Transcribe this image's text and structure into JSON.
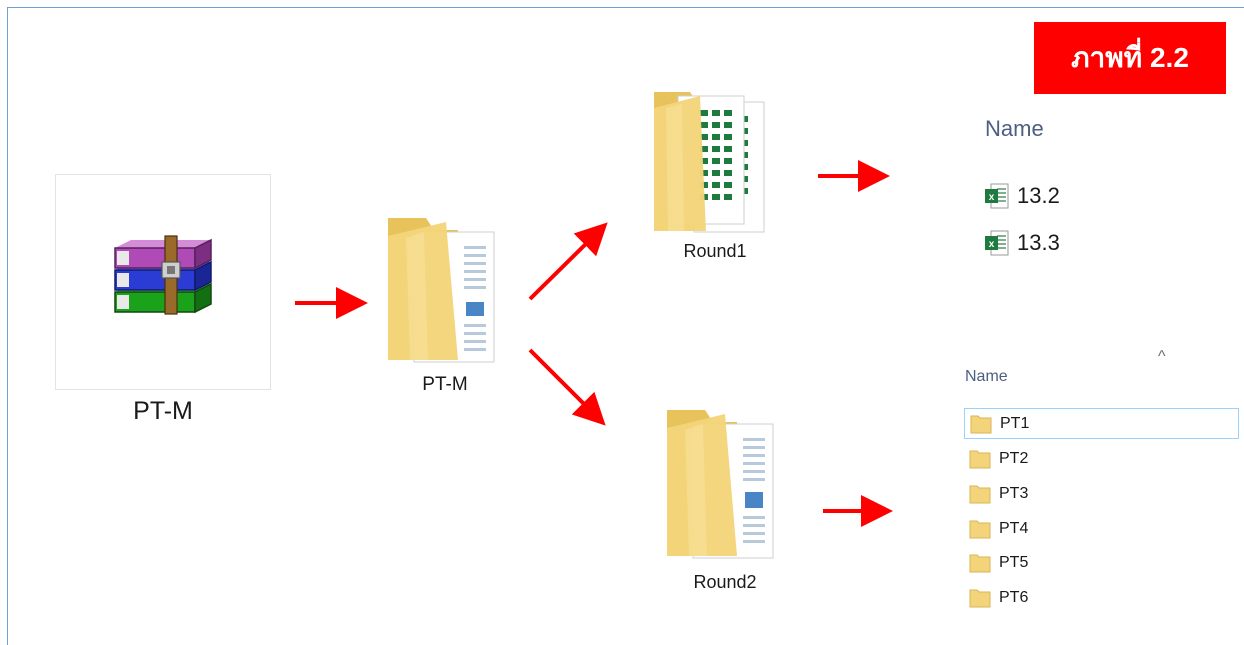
{
  "badge": {
    "text": "ภาพที่ 2.2"
  },
  "archive": {
    "label": "PT-M",
    "icon": "winrar-archive-icon"
  },
  "folders": {
    "main": {
      "label": "PT-M",
      "icon": "folder-with-documents-icon"
    },
    "round1": {
      "label": "Round1",
      "icon": "folder-with-spreadsheets-icon"
    },
    "round2": {
      "label": "Round2",
      "icon": "folder-with-documents-icon"
    }
  },
  "round1_listing": {
    "header": "Name",
    "files": [
      {
        "name": "13.2",
        "icon": "excel-file-icon"
      },
      {
        "name": "13.3",
        "icon": "excel-file-icon"
      }
    ]
  },
  "round2_listing": {
    "header": "Name",
    "sort_indicator": "^",
    "folders": [
      {
        "name": "PT1",
        "icon": "folder-icon",
        "selected": true
      },
      {
        "name": "PT2",
        "icon": "folder-icon"
      },
      {
        "name": "PT3",
        "icon": "folder-icon"
      },
      {
        "name": "PT4",
        "icon": "folder-icon"
      },
      {
        "name": "PT5",
        "icon": "folder-icon"
      },
      {
        "name": "PT6",
        "icon": "folder-icon"
      }
    ]
  },
  "colors": {
    "arrow": "#ff0000",
    "badge_bg": "#ff0000",
    "badge_text": "#ffffff",
    "folder": "#f4d47a",
    "excel_green": "#1f7a3f",
    "frame_border": "#6f9fd4"
  }
}
